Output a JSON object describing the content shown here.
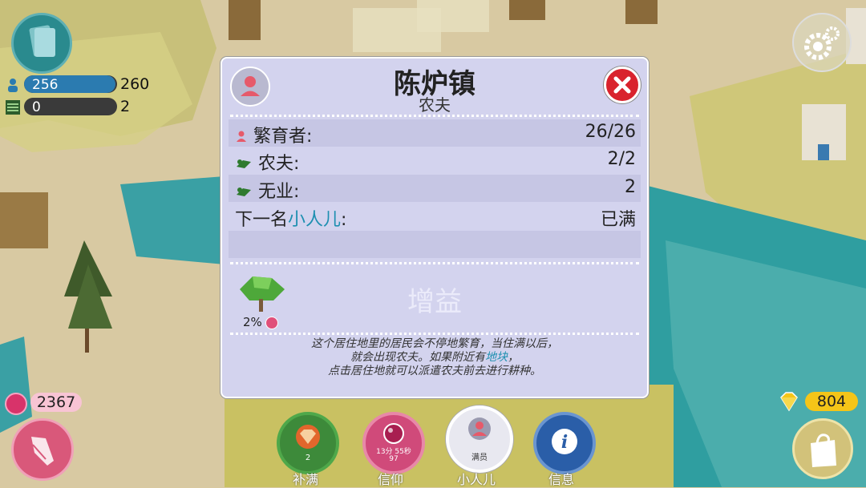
{
  "hud": {
    "population_current": "256",
    "population_max": "260",
    "storage_current": "0",
    "storage_max": "2",
    "mana_value": "2367",
    "gems_value": "804",
    "population_fill_fraction": 0.98
  },
  "dialog": {
    "title": "陈炉镇",
    "subtitle": "农夫",
    "rows": [
      {
        "label": "繁育者:",
        "value": "26/26"
      },
      {
        "label": "农夫:",
        "value": "2/2"
      },
      {
        "label": "无业:",
        "value": "2"
      },
      {
        "label_prefix": "下一名",
        "label_link": "小人儿",
        "label_suffix": ":",
        "value": "已满"
      }
    ],
    "boost_label": "增益",
    "boost_percent": "2%",
    "description_line1": "这个居住地里的居民会不停地繁育，当住满以后，",
    "description_line2_prefix": "就会出现农夫。如果附近有",
    "description_line2_link": "地块",
    "description_line2_suffix": "，",
    "description_line3": "点击居住地就可以派遣农夫前去进行耕种。"
  },
  "bottom_bar": {
    "buttons": [
      {
        "label": "补满",
        "badge": "2"
      },
      {
        "label": "信仰",
        "badge_line1": "13分 55秒",
        "badge_line2": "97"
      },
      {
        "label": "小人儿",
        "badge": "满员"
      },
      {
        "label": "信息"
      }
    ]
  },
  "colors": {
    "dialog_bg": "#d3d3ee",
    "close_red": "#d9232d",
    "gem_yellow": "#f5c518",
    "mana_pink": "#e0507a",
    "population_blue": "#2b7bb0"
  }
}
